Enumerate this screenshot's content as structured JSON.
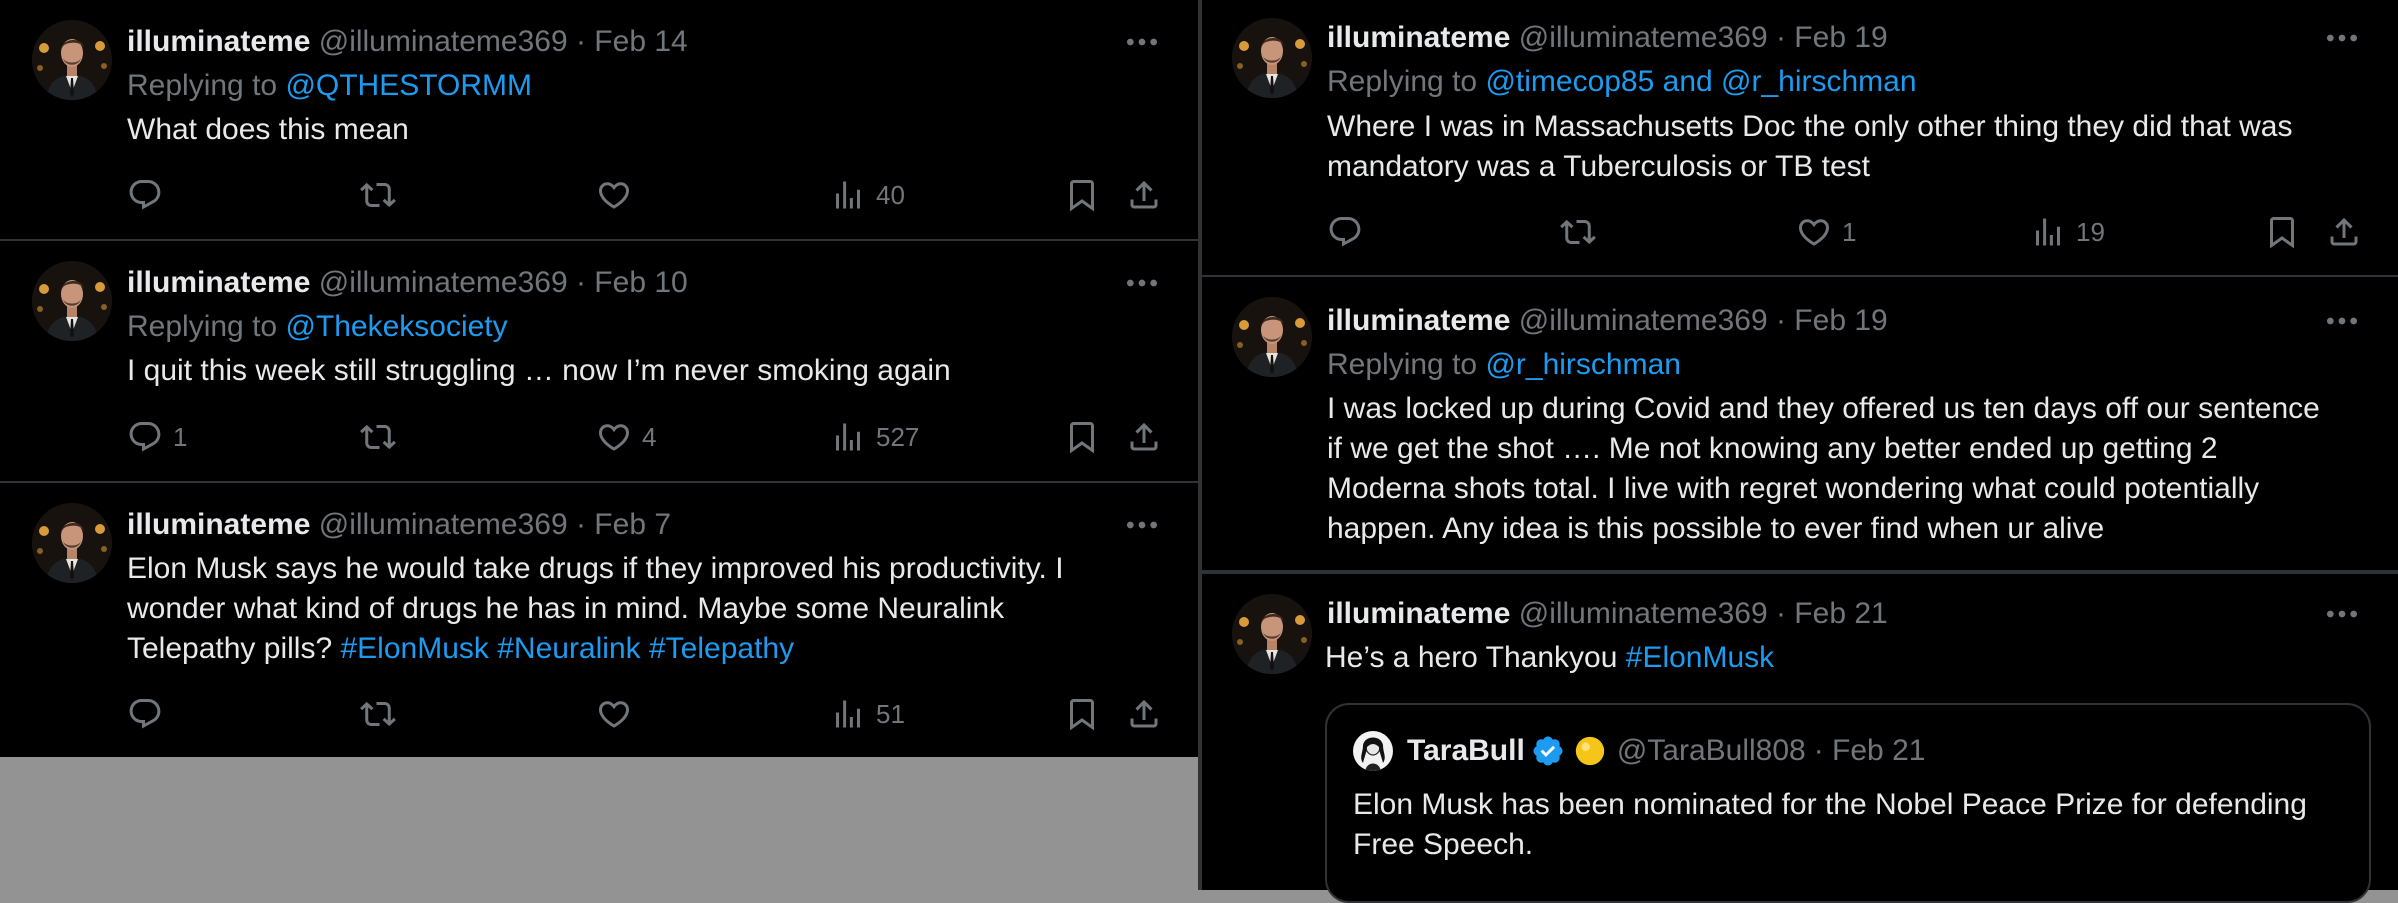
{
  "left_tweets": [
    {
      "name": "illuminateme",
      "handle": "@illuminateme369",
      "date": "· Feb 14",
      "replying_prefix": "Replying to",
      "replying_to": "@QTHESTORMM",
      "text_lines": [
        "What does this mean"
      ],
      "replies": "",
      "likes": "",
      "views": "40"
    },
    {
      "name": "illuminateme",
      "handle": "@illuminateme369",
      "date": "· Feb 10",
      "replying_prefix": "Replying to",
      "replying_to": "@Thekeksociety",
      "text_lines": [
        "I quit this week still struggling … now I’m never smoking again"
      ],
      "replies": "1",
      "likes": "4",
      "views": "527"
    },
    {
      "name": "illuminateme",
      "handle": "@illuminateme369",
      "date": "· Feb 7",
      "text_lines": [
        "Elon Musk says he would take drugs if they improved his productivity. I",
        "wonder what kind of drugs he has in mind. Maybe some Neuralink",
        "Telepathy pills?"
      ],
      "hashtags": [
        "#ElonMusk",
        "#Neuralink",
        "#Telepathy"
      ],
      "replies": "",
      "likes": "",
      "views": "51"
    }
  ],
  "right_tweets": [
    {
      "name": "illuminateme",
      "handle": "@illuminateme369",
      "date": "· Feb 19",
      "replying_prefix": "Replying to",
      "replying_to": "@timecop85 and @r_hirschman",
      "text_lines": [
        "Where I was in Massachusetts Doc the only other thing they did that was",
        "mandatory was a Tuberculosis or TB test"
      ],
      "replies": "",
      "likes": "1",
      "views": "19"
    },
    {
      "name": "illuminateme",
      "handle": "@illuminateme369",
      "date": "· Feb 19",
      "replying_prefix": "Replying to",
      "replying_to": "@r_hirschman",
      "text_lines": [
        "I was locked up during Covid and they offered us ten days off our sentence",
        "if we get the shot …. Me not knowing any better ended up getting 2",
        "Moderna shots total. I live with regret wondering what could potentially",
        "happen. Any idea is this possible to ever find when ur alive"
      ]
    },
    {
      "name": "illuminateme",
      "handle": "@illuminateme369",
      "date": "· Feb 21",
      "text": "He’s a hero Thankyou",
      "hashtag": "#ElonMusk",
      "quote": {
        "name": "TaraBull",
        "handle": "@TaraBull808",
        "date": "· Feb 21",
        "text_lines": [
          "Elon Musk has been nominated for the Nobel Peace Prize for defending",
          "Free Speech."
        ]
      }
    }
  ],
  "icons": {
    "reply": "reply-icon",
    "retweet": "retweet-icon",
    "like": "like-icon",
    "views": "views-icon",
    "bookmark": "bookmark-icon",
    "share": "share-icon",
    "more": "more-icon",
    "verified": "verified-badge-icon",
    "emoji": "yellow-circle-emoji"
  },
  "colors": {
    "background": "#000000",
    "text": "#e7e9ea",
    "muted": "#71767b",
    "link": "#1d9bf0",
    "divider": "#2f3336",
    "verified": "#1d9bf0",
    "gap_gray": "#939393"
  }
}
